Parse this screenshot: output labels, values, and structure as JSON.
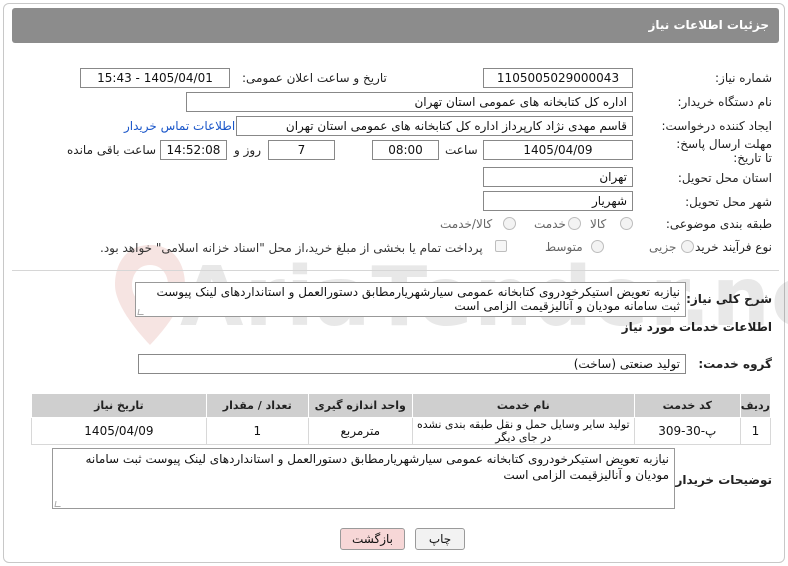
{
  "header": {
    "title": "جزئیات اطلاعات نیاز"
  },
  "form": {
    "need_number_label": "شماره نیاز:",
    "need_number": "1105005029000043",
    "announce_label": "تاریخ و ساعت اعلان عمومی:",
    "announce_value": "1405/04/01 - 15:43",
    "buyer_org_label": "نام دستگاه خریدار:",
    "buyer_org": "اداره کل کتابخانه های عمومی استان تهران",
    "requester_label": "ایجاد کننده درخواست:",
    "requester": "قاسم مهدی نژاد کارپرداز اداره کل کتابخانه های عمومی استان تهران",
    "contact_link": "اطلاعات تماس خریدار",
    "deadline_label": "مهلت ارسال پاسخ: تا تاریخ:",
    "deadline_date": "1405/04/09",
    "time_label": "ساعت",
    "deadline_time": "08:00",
    "days_value": "7",
    "days_label": "روز و",
    "remaining_time": "14:52:08",
    "remaining_label": "ساعت باقی مانده",
    "province_label": "استان محل تحویل:",
    "province": "تهران",
    "city_label": "شهر محل تحویل:",
    "city": "شهریار",
    "category_label": "طبقه بندی موضوعی:",
    "category_options": [
      "کالا",
      "خدمت",
      "کالا/خدمت"
    ],
    "process_label": "نوع فرآیند خرید :",
    "process_options": [
      "جزیی",
      "متوسط"
    ],
    "payment_note": "پرداخت تمام یا بخشی از مبلغ خرید،از محل \"اسناد خزانه اسلامی\" خواهد بود."
  },
  "summary": {
    "label": "شرح کلی نیاز:",
    "text": "نیازبه تعویض استیکرخودروی کتابخانه عمومی سیارشهریارمطابق دستورالعمل و استانداردهای لینک پیوست ثبت سامانه مودیان و آنالیزقیمت الزامی است"
  },
  "services": {
    "section_title": "اطلاعات خدمات مورد نیاز",
    "group_label": "گروه خدمت:",
    "group_value": "تولید صنعتی (ساخت)",
    "columns": [
      "ردیف",
      "کد خدمت",
      "نام خدمت",
      "واحد اندازه گیری",
      "تعداد / مقدار",
      "تاریخ نیاز"
    ],
    "rows": [
      [
        "1",
        "پ-30-309",
        "تولید سایر وسایل حمل و نقل طبقه بندی نشده در جای دیگر",
        "مترمربع",
        "1",
        "1405/04/09"
      ]
    ]
  },
  "buyer_notes": {
    "label": "توضیحات خریدار:",
    "text": "نیازبه تعویض استیکرخودروی کتابخانه عمومی سیارشهریارمطابق دستورالعمل و استانداردهای لینک پیوست ثبت سامانه مودیان و آنالیزقیمت الزامی است"
  },
  "buttons": {
    "print": "چاپ",
    "back": "بازگشت"
  },
  "watermark": "AriaTender.net",
  "colors": {
    "header_bg": "#8c8c8c",
    "link": "#1a56c9",
    "back_btn": "#f7d7d7",
    "print_btn": "#f2f2f2"
  }
}
